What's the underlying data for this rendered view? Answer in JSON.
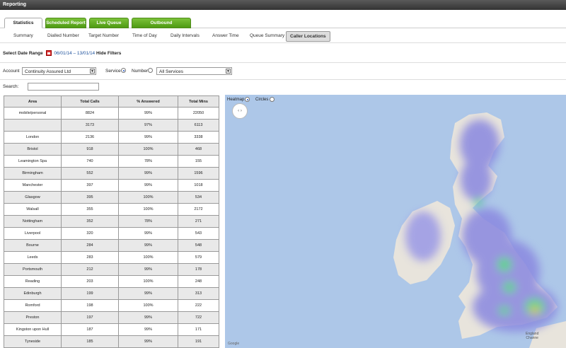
{
  "window": {
    "title": "Reporting"
  },
  "tabs": [
    {
      "label": "Statistics"
    },
    {
      "label": "Scheduled Report"
    },
    {
      "label": "Live Queue"
    },
    {
      "label": "Outbound"
    }
  ],
  "subnav": [
    {
      "label": "Summary"
    },
    {
      "label": "Dialled Number"
    },
    {
      "label": "Target Number"
    },
    {
      "label": "Time of Day"
    },
    {
      "label": "Daily Intervals"
    },
    {
      "label": "Answer Time"
    },
    {
      "label": "Queue Summary"
    },
    {
      "label": "Caller Locations"
    }
  ],
  "date_filter": {
    "label": "Select Date Range",
    "range": "06/01/14 – 13/01/14",
    "hide_label": "Hide Filters"
  },
  "filters": {
    "account_label": "Account",
    "account_value": "Continuity Assured Ltd",
    "service_label": "Service",
    "number_label": "Number",
    "service_value": "All Services"
  },
  "search": {
    "label": "Search:",
    "value": ""
  },
  "table": {
    "headers": [
      "Area",
      "Total Calls",
      "% Answered",
      "Total Mins"
    ],
    "rows": [
      [
        "mobile/personal",
        "8824",
        "99%",
        "22050"
      ],
      [
        "",
        "3173",
        "97%",
        "6113"
      ],
      [
        "London",
        "2136",
        "99%",
        "3338"
      ],
      [
        "Bristol",
        "918",
        "100%",
        "468"
      ],
      [
        "Leamington Spa",
        "740",
        "78%",
        "155"
      ],
      [
        "Birmingham",
        "552",
        "99%",
        "1596"
      ],
      [
        "Manchester",
        "397",
        "99%",
        "1018"
      ],
      [
        "Glasgow",
        "395",
        "100%",
        "534"
      ],
      [
        "Walsall",
        "355",
        "100%",
        "2172"
      ],
      [
        "Nottingham",
        "352",
        "78%",
        "271"
      ],
      [
        "Liverpool",
        "320",
        "99%",
        "543"
      ],
      [
        "Bourne",
        "284",
        "99%",
        "548"
      ],
      [
        "Leeds",
        "283",
        "100%",
        "579"
      ],
      [
        "Portsmouth",
        "212",
        "99%",
        "178"
      ],
      [
        "Reading",
        "203",
        "100%",
        "248"
      ],
      [
        "Edinburgh",
        "199",
        "99%",
        "313"
      ],
      [
        "Romford",
        "198",
        "100%",
        "222"
      ],
      [
        "Preston",
        "197",
        "99%",
        "722"
      ],
      [
        "Kingston upon Hull",
        "187",
        "99%",
        "171"
      ],
      [
        "Tyneside",
        "185",
        "99%",
        "191"
      ]
    ]
  },
  "map": {
    "heatmap_label": "Heatmap",
    "circles_label": "Circles",
    "attribution": "England\nChanne",
    "google_label": "Google",
    "colors": {
      "water": "#adc7e8",
      "land": "#e8e4dc",
      "heat_low": "#8a88e0",
      "heat_mid": "#45d07a",
      "heat_high": "#e8452c"
    }
  },
  "icons": {
    "calendar": "calendar-icon",
    "pan": "pan-control-icon",
    "dropdown": "chevron-down-icon"
  }
}
